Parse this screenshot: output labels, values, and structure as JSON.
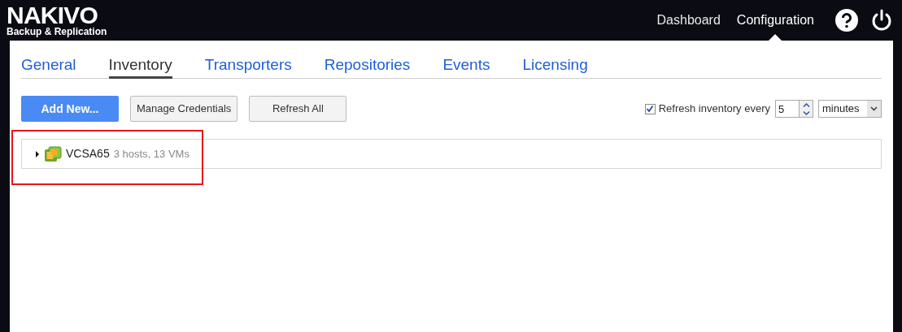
{
  "logo": {
    "brand": "NAKIVO",
    "product": "Backup & Replication"
  },
  "nav": [
    {
      "label": "Dashboard",
      "selected": false
    },
    {
      "label": "Configuration",
      "selected": true
    }
  ],
  "tabs": [
    {
      "label": "General",
      "selected": false
    },
    {
      "label": "Inventory",
      "selected": true
    },
    {
      "label": "Transporters",
      "selected": false
    },
    {
      "label": "Repositories",
      "selected": false
    },
    {
      "label": "Events",
      "selected": false
    },
    {
      "label": "Licensing",
      "selected": false
    }
  ],
  "toolbar": {
    "buttons": [
      {
        "label": "Add New...",
        "kind": "primary"
      },
      {
        "label": "Manage Credentials",
        "kind": "secondary"
      },
      {
        "label": "Refresh All",
        "kind": "secondary"
      }
    ],
    "auto_refresh": {
      "checked": true,
      "label": "Refresh inventory every",
      "value": "5",
      "unit": "minutes"
    }
  },
  "inventory": [
    {
      "name": "VCSA65",
      "summary": "3 hosts, 13 VMs",
      "expanded": false,
      "highlighted": true
    }
  ]
}
